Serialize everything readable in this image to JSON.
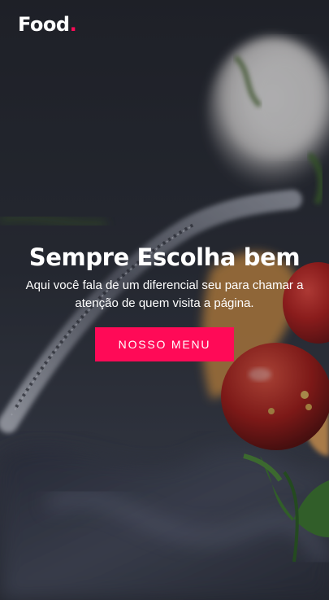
{
  "header": {
    "logo_text": "Food",
    "logo_dot": "."
  },
  "hero": {
    "title": "Sempre Escolha bem",
    "text": "Aqui você fala de um diferencial seu para chamar a atenção de quem visita a página.",
    "button_label": "NOSSO MENU"
  },
  "colors": {
    "accent": "#ff0a57",
    "text": "#ffffff"
  }
}
